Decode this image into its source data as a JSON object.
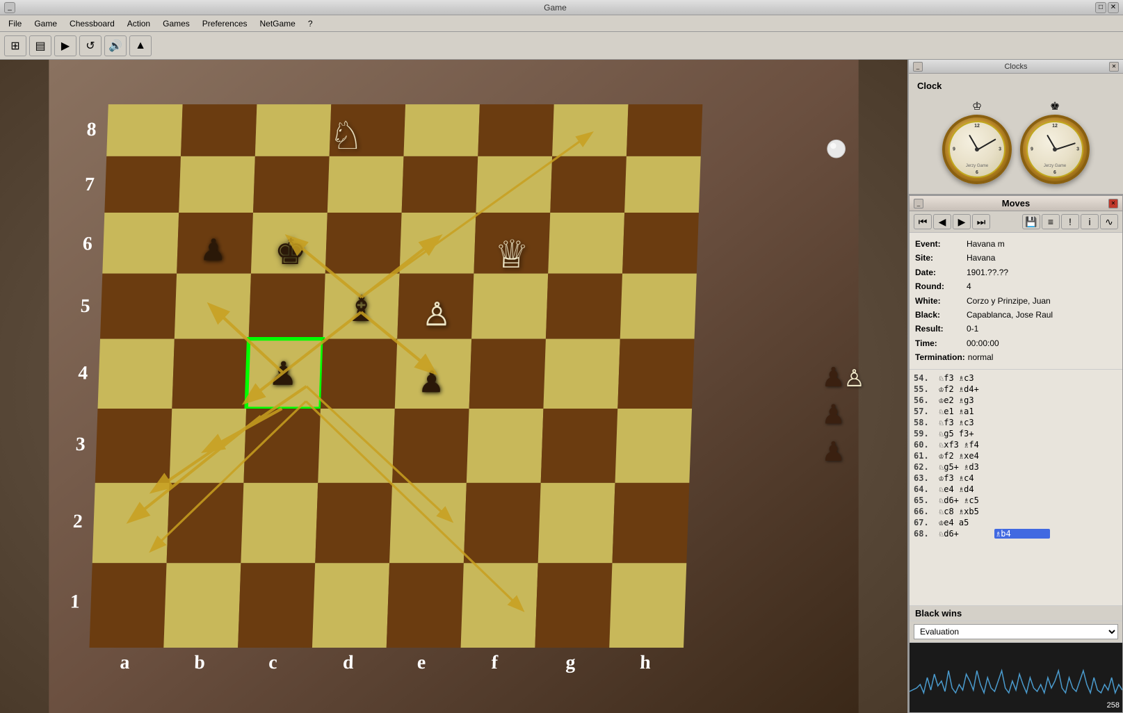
{
  "window": {
    "title": "Game",
    "clock_window_title": "Clocks"
  },
  "menu": {
    "items": [
      "File",
      "Game",
      "Chessboard",
      "Action",
      "Games",
      "Preferences",
      "NetGame",
      "?"
    ]
  },
  "toolbar": {
    "buttons": [
      {
        "name": "new-button",
        "icon": "⊞",
        "label": "New"
      },
      {
        "name": "open-button",
        "icon": "▤",
        "label": "Open"
      },
      {
        "name": "play-button",
        "icon": "▶",
        "label": "Play"
      },
      {
        "name": "rotate-button",
        "icon": "↺",
        "label": "Rotate"
      },
      {
        "name": "sound-button",
        "icon": "🔊",
        "label": "Sound"
      },
      {
        "name": "flag-button",
        "icon": "▲",
        "label": "Flag"
      }
    ]
  },
  "clock": {
    "label": "Clock",
    "white_crown": "♔",
    "black_crown": "♚",
    "white_hour": 330,
    "white_minute": 60,
    "black_hour": 330,
    "black_minute": 72
  },
  "moves_panel": {
    "title": "Moves",
    "nav_buttons": [
      "⏮",
      "◀",
      "▶",
      "⏭"
    ],
    "save_icon": "💾",
    "tools": [
      "≡",
      "!",
      "i",
      "∿"
    ]
  },
  "game_info": {
    "event_label": "Event:",
    "event_val": "Havana m",
    "site_label": "Site:",
    "site_val": "Havana",
    "date_label": "Date:",
    "date_val": "1901.??.??",
    "round_label": "Round:",
    "round_val": "4",
    "white_label": "White:",
    "white_val": "Corzo y Prinzipe, Juan",
    "black_label": "Black:",
    "black_val": "Capablanca, Jose Raul",
    "result_label": "Result:",
    "result_val": "0-1",
    "time_label": "Time:",
    "time_val": "00:00:00",
    "termination_label": "Termination:",
    "termination_val": "normal"
  },
  "moves": [
    {
      "num": "54.",
      "white": "♘f3 ♗c3",
      "black": ""
    },
    {
      "num": "55.",
      "white": "♔f2 ♗d4+",
      "black": ""
    },
    {
      "num": "56.",
      "white": "♔e2 ♗g3",
      "black": ""
    },
    {
      "num": "57.",
      "white": "♘e1 ♗a1",
      "black": ""
    },
    {
      "num": "58.",
      "white": "♘f3 ♗c3",
      "black": ""
    },
    {
      "num": "59.",
      "white": "♘g5 f3+",
      "black": ""
    },
    {
      "num": "60.",
      "white": "♘xf3 ♗f4",
      "black": ""
    },
    {
      "num": "61.",
      "white": "♔f2 ♗xe4",
      "black": ""
    },
    {
      "num": "62.",
      "white": "♘g5+ ♗d3",
      "black": ""
    },
    {
      "num": "63.",
      "white": "♔f3 ♗c4",
      "black": ""
    },
    {
      "num": "64.",
      "white": "♘e4 ♗d4",
      "black": ""
    },
    {
      "num": "65.",
      "white": "♘d6+ ♗c5",
      "black": ""
    },
    {
      "num": "66.",
      "white": "♘c8 ♗xb5",
      "black": ""
    },
    {
      "num": "67.",
      "white": "♔e4 a5",
      "black": ""
    },
    {
      "num": "68.",
      "white": "♘d6+",
      "black": "♗b4"
    }
  ],
  "status": {
    "text": "Black wins"
  },
  "evaluation": {
    "label": "Evaluation",
    "graph_number": "258"
  },
  "board": {
    "rank_labels": [
      "8",
      "7",
      "6",
      "5",
      "4",
      "3",
      "2",
      "1"
    ],
    "file_labels": [
      "a",
      "b",
      "c",
      "d",
      "e",
      "f",
      "g",
      "h"
    ],
    "selected_square": "c4"
  }
}
